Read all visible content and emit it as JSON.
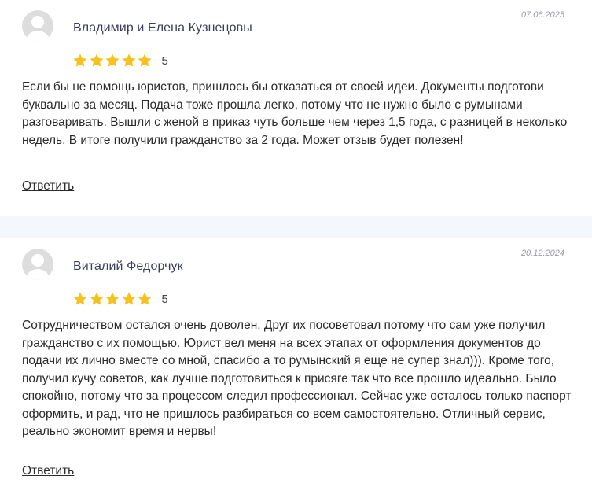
{
  "reviews": [
    {
      "author": "Владимир и Елена Кузнецовы",
      "date": "07.06.2025",
      "rating": 5,
      "rating_label": "5",
      "text": "Если бы не помощь юристов, пришлось бы отказаться от своей идеи. Документы подготови буквально за месяц. Подача тоже прошла легко, потому что не нужно было с румынами разговаривать. Вышли с женой в приказ чуть больше чем через 1,5 года, с разницей в неколько недель. В итоге получили гражданство за 2 года. Может отзыв будет полезен!",
      "reply_label": "Ответить",
      "avatar_icon": "user-avatar-placeholder-icon"
    },
    {
      "author": "Виталий Федорчук",
      "date": "20.12.2024",
      "rating": 5,
      "rating_label": "5",
      "text": "Сотрудничеством остался очень доволен. Друг их посоветовал потому что сам уже получил гражданство с их помощью. Юрист вел меня на всех этапах от оформления документов до подачи их лично вместе со мной, спасибо а то румынский я еще не супер знал))). Кроме того, получил кучу советов, как лучше подготовиться к присяге так что все прошло идеально. Было спокойно, потому что за процессом следил профессионал. Сейчас уже осталось только паспорт оформить, и рад, что не пришлось разбираться со всем самостоятельно. Отличный сервис, реально экономит время и нервы!",
      "reply_label": "Ответить",
      "avatar_icon": "user-avatar-placeholder-icon"
    }
  ],
  "colors": {
    "star": "#f7c21d",
    "divider": "#f4f7fd",
    "author": "#3d3d5c",
    "date": "#9a9aa6"
  }
}
